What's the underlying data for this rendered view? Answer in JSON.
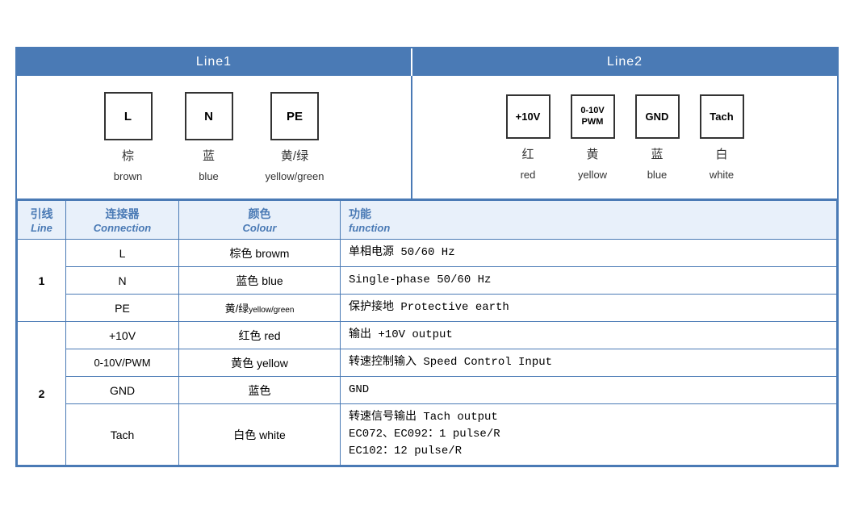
{
  "header": {
    "line1_label": "Line1",
    "line2_label": "Line2"
  },
  "line1_connectors": [
    {
      "symbol": "L",
      "cn": "棕",
      "en": "brown"
    },
    {
      "symbol": "N",
      "cn": "蓝",
      "en": "blue"
    },
    {
      "symbol": "PE",
      "cn": "黄/绿",
      "en": "yellow/green"
    }
  ],
  "line2_connectors": [
    {
      "symbol": "+10V",
      "cn": "红",
      "en": "red"
    },
    {
      "symbol": "0-10V\nPWM",
      "cn": "黄",
      "en": "yellow"
    },
    {
      "symbol": "GND",
      "cn": "蓝",
      "en": "blue"
    },
    {
      "symbol": "Tach",
      "cn": "白",
      "en": "white"
    }
  ],
  "table": {
    "headers": {
      "line_cn": "引线",
      "line_en": "Line",
      "connection_cn": "连接器",
      "connection_en": "Connection",
      "colour_cn": "颜色",
      "colour_en": "Colour",
      "function_cn": "功能",
      "function_en": "function"
    },
    "rows": [
      {
        "line": "1",
        "rowspan": 3,
        "connection": "L",
        "colour": "棕色 browm",
        "function": "单相电源 50/60 Hz"
      },
      {
        "line": "",
        "connection": "N",
        "colour": "蓝色 blue",
        "function": "Single-phase 50/60 Hz"
      },
      {
        "line": "",
        "connection": "PE",
        "colour": "黄/绿yellow/green",
        "function": "保护接地 Protective earth"
      },
      {
        "line": "2",
        "rowspan": 4,
        "connection": "+10V",
        "colour": "红色 red",
        "function": "输出 +10V output"
      },
      {
        "line": "",
        "connection": "0-10V/PWM",
        "colour": "黄色 yellow",
        "function": "转速控制输入 Speed Control Input"
      },
      {
        "line": "",
        "connection": "GND",
        "colour": "蓝色",
        "function": "GND"
      },
      {
        "line": "",
        "connection": "Tach",
        "colour": "白色 white",
        "function": "转速信号输出 Tach output\nEC072、EC092：1 pulse/R\nEC102：12 pulse/R"
      }
    ]
  }
}
